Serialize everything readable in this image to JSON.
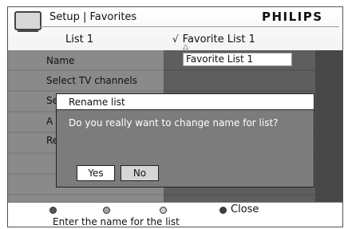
{
  "header": {
    "title": "Setup | Favorites",
    "brand": "PHILIPS",
    "list_label": "List 1",
    "current_list": "Favorite List 1",
    "check_glyph": "√",
    "icon": "tv-icon"
  },
  "menu": {
    "items": [
      {
        "label": "Name"
      },
      {
        "label": "Select TV channels"
      },
      {
        "label": "Se"
      },
      {
        "label": "A"
      },
      {
        "label": "Re"
      }
    ]
  },
  "edit_field": {
    "value": "Favorite List 1",
    "up_arrow": "△",
    "down_arrow": "▽"
  },
  "dialog": {
    "title": "Rename list",
    "message": "Do you really want to change name for list?",
    "yes_label": "Yes",
    "no_label": "No"
  },
  "footer": {
    "close_label": "Close",
    "hint": "Enter the name for the list",
    "buttons": [
      "red-button-icon",
      "green-button-icon",
      "yellow-button-icon",
      "blue-button-icon"
    ]
  }
}
